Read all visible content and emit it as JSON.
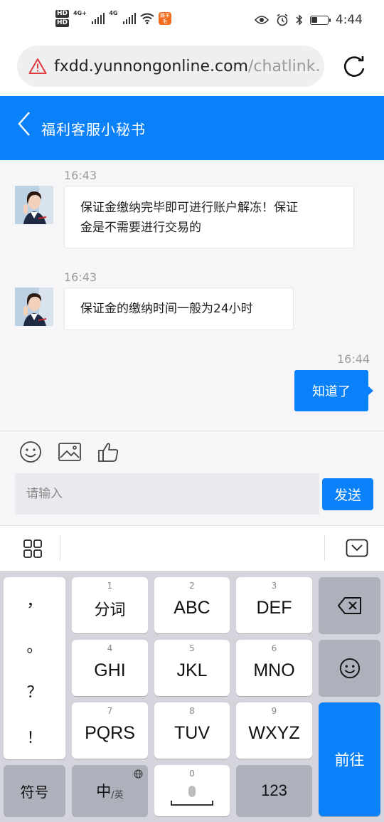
{
  "status_bar": {
    "hd_labels": [
      "HD",
      "HD"
    ],
    "network_labels": [
      "4G+",
      "4G"
    ],
    "app_badge": "薅羊毛",
    "time": "4:44",
    "icons": [
      "eye-icon",
      "alarm-icon",
      "bluetooth-icon",
      "battery-icon"
    ]
  },
  "browser": {
    "url_host": "fxdd.yunnongonline.com",
    "url_path": "/chatlink.",
    "security_icon": "warning-triangle-icon",
    "reload_icon": "reload-icon"
  },
  "chat": {
    "title": "福利客服小秘书",
    "back_icon": "chevron-left-icon",
    "messages": [
      {
        "time": "16:43",
        "text_line1": "保证金缴纳完毕即可进行账户解冻！保证",
        "text_line2": "金是不需要进行交易的",
        "sender": "agent"
      },
      {
        "time": "16:43",
        "text": "保证金的缴纳时间一般为24小时",
        "sender": "agent"
      },
      {
        "time": "16:44",
        "text": "知道了",
        "sender": "me"
      }
    ]
  },
  "composer": {
    "tools": [
      "emoji-icon",
      "image-icon",
      "thumbs-up-icon"
    ],
    "placeholder": "请输入",
    "send_label": "发送"
  },
  "keyboard": {
    "punct": [
      "，",
      "。",
      "？",
      "！"
    ],
    "keys": [
      {
        "num": "1",
        "label": "分词"
      },
      {
        "num": "2",
        "label": "ABC"
      },
      {
        "num": "3",
        "label": "DEF"
      },
      {
        "num": "4",
        "label": "GHI"
      },
      {
        "num": "5",
        "label": "JKL"
      },
      {
        "num": "6",
        "label": "MNO"
      },
      {
        "num": "7",
        "label": "PQRS"
      },
      {
        "num": "8",
        "label": "TUV"
      },
      {
        "num": "9",
        "label": "WXYZ"
      }
    ],
    "symbols_label": "符号",
    "lang_label": "中",
    "lang_alt": "/英",
    "space_num": "0",
    "numbers_label": "123",
    "go_label": "前往"
  },
  "colors": {
    "accent": "#0a80f9",
    "chat_bg": "#f6f6f8",
    "keyboard_bg": "#d3d4dc",
    "warning": "#e0393e"
  }
}
